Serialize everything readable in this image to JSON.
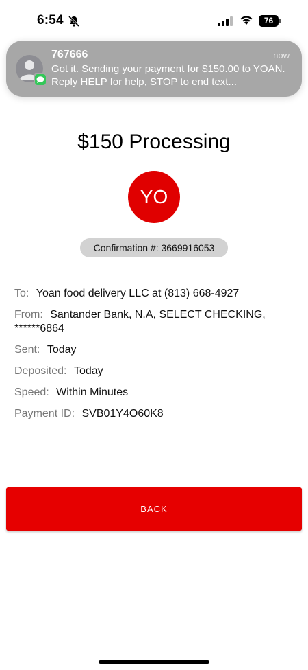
{
  "status_bar": {
    "time": "6:54",
    "battery": "76",
    "icons": [
      "bell-slash-icon",
      "cellular-signal-icon",
      "wifi-icon",
      "battery-icon"
    ]
  },
  "notification": {
    "sender": "767666",
    "time": "now",
    "message": "Got it. Sending your payment for $150.00 to YOAN. Reply HELP for help, STOP to end text..."
  },
  "payment": {
    "title": "$150 Processing",
    "initials": "YO",
    "confirmation": "Confirmation #: 3669916053",
    "accent_color": "#e60000"
  },
  "details": {
    "to_label": "To:",
    "to_value": "Yoan food delivery LLC at (813) 668-4927",
    "from_label": "From:",
    "from_value": "Santander Bank, N.A, SELECT CHECKING, ******6864",
    "sent_label": "Sent:",
    "sent_value": "Today",
    "deposited_label": "Deposited:",
    "deposited_value": "Today",
    "speed_label": "Speed:",
    "speed_value": "Within Minutes",
    "payment_id_label": "Payment ID:",
    "payment_id_value": "SVB01Y4O60K8"
  },
  "actions": {
    "back_label": "BACK"
  }
}
